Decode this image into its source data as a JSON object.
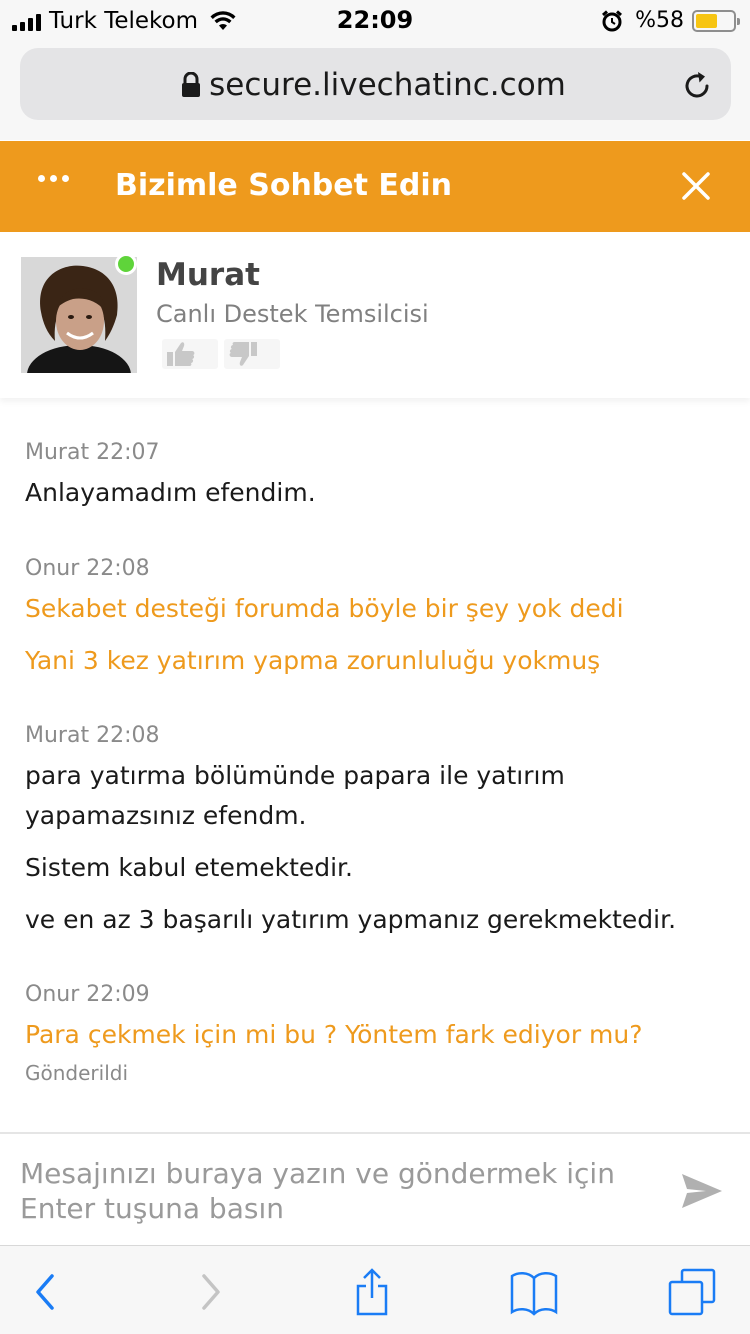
{
  "status_bar": {
    "carrier": "Turk Telekom",
    "time": "22:09",
    "battery_percent": "%58",
    "battery_level": 0.58
  },
  "browser": {
    "url": "secure.livechatinc.com"
  },
  "chat_header": {
    "title": "Bizimle Sohbet Edin"
  },
  "agent": {
    "name": "Murat",
    "role": "Canlı Destek Temsilcisi",
    "status_color": "#5fd43a"
  },
  "messages": [
    {
      "author": "Murat",
      "time": "22:07",
      "meta": "Murat 22:07",
      "type": "agent",
      "lines": [
        "Anlayamadım efendim."
      ]
    },
    {
      "author": "Onur",
      "time": "22:08",
      "meta": "Onur 22:08",
      "type": "visitor",
      "lines": [
        "Sekabet desteği forumda böyle bir şey yok dedi",
        "Yani 3 kez yatırım yapma zorunluluğu yokmuş"
      ]
    },
    {
      "author": "Murat",
      "time": "22:08",
      "meta": "Murat 22:08",
      "type": "agent",
      "lines": [
        "para yatırma bölümünde papara ile yatırım",
        "yapamazsınız efendm.",
        "Sistem kabul etemektedir.",
        "ve en az 3 başarılı yatırım yapmanız gerekmektedir."
      ]
    },
    {
      "author": "Onur",
      "time": "22:09",
      "meta": "Onur 22:09",
      "type": "visitor",
      "lines": [
        "Para çekmek için mi bu ? Yöntem fark ediyor mu?"
      ],
      "status": "Gönderildi"
    }
  ],
  "input": {
    "placeholder": "Mesajınızı buraya yazın ve göndermek için Enter tuşuna basın",
    "value": ""
  },
  "colors": {
    "accent": "#ee9a1d",
    "agent_text": "#1a1a1a",
    "visitor_text": "#ee9a1d",
    "ios_blue": "#1a7cf5"
  },
  "icons": {
    "menu": "more-dots-icon",
    "close": "close-icon",
    "send": "send-icon",
    "rate_good": "thumbs-up-icon",
    "rate_bad": "thumbs-down-icon",
    "back": "chevron-left-icon",
    "forward": "chevron-right-icon",
    "share": "share-icon",
    "bookmarks": "book-icon",
    "tabs": "tabs-icon"
  }
}
